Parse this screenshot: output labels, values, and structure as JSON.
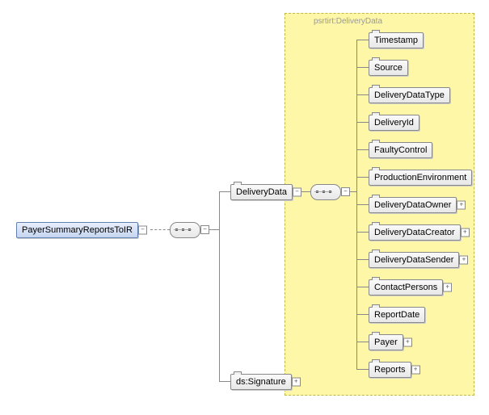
{
  "root": {
    "label": "PayerSummaryReportsToIR"
  },
  "seq1": {},
  "deliveryData": {
    "label": "DeliveryData"
  },
  "signature": {
    "label": "ds:Signature"
  },
  "seq2": {},
  "group": {
    "label": "psrtirt:DeliveryData"
  },
  "children": [
    {
      "label": "Timestamp",
      "expandable": false
    },
    {
      "label": "Source",
      "expandable": false
    },
    {
      "label": "DeliveryDataType",
      "expandable": false
    },
    {
      "label": "DeliveryId",
      "expandable": false
    },
    {
      "label": "FaultyControl",
      "expandable": false
    },
    {
      "label": "ProductionEnvironment",
      "expandable": false
    },
    {
      "label": "DeliveryDataOwner",
      "expandable": true
    },
    {
      "label": "DeliveryDataCreator",
      "expandable": true
    },
    {
      "label": "DeliveryDataSender",
      "expandable": true
    },
    {
      "label": "ContactPersons",
      "expandable": true
    },
    {
      "label": "ReportDate",
      "expandable": false
    },
    {
      "label": "Payer",
      "expandable": true
    },
    {
      "label": "Reports",
      "expandable": true
    }
  ]
}
